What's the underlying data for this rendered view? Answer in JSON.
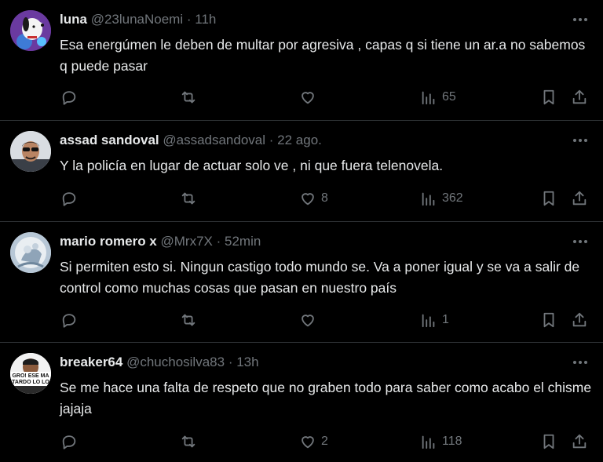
{
  "tweets": [
    {
      "name": "luna",
      "handle": "@23lunaNoemi",
      "sep": "·",
      "time": "11h",
      "text": "Esa energúmen le deben de multar por agresiva , capas q si tiene un ar.a no sabemos q puede pasar",
      "likes": "",
      "views": "65"
    },
    {
      "name": "assad sandoval",
      "handle": "@assadsandoval",
      "sep": "·",
      "time": "22 ago.",
      "text": "Y la policía en lugar de actuar solo ve , ni que fuera telenovela.",
      "likes": "8",
      "views": "362"
    },
    {
      "name": "mario romero x",
      "handle": "@Mrx7X",
      "sep": "·",
      "time": "52min",
      "text": "Si permiten esto si. Ningun castigo todo mundo se. Va a poner igual y se va a salir de control como muchas cosas que pasan en nuestro país",
      "likes": "",
      "views": "1"
    },
    {
      "name": "breaker64",
      "handle": "@chuchosilva83",
      "sep": "·",
      "time": "13h",
      "text": "Se me hace una falta de respeto que no graben todo para saber como acabo el chisme jajaja",
      "likes": "2",
      "views": "118",
      "avatar_text": "GRO! ESE MA TARDO LO LO"
    }
  ],
  "colors": {
    "background": "#000000",
    "text": "#e7e9ea",
    "muted": "#71767b",
    "border": "#2f3336"
  },
  "icons": [
    "reply-icon",
    "retweet-icon",
    "like-icon",
    "views-icon",
    "bookmark-icon",
    "share-icon",
    "more-icon"
  ]
}
